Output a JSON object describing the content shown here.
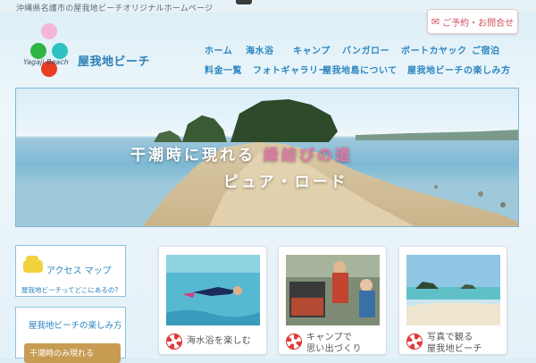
{
  "header": {
    "tagline": "沖縄県名護市の屋我地ビーチオリジナルホームページ",
    "reserve_icon": "envelope-icon",
    "reserve_label": "ご予約・お問合せ"
  },
  "logo": {
    "english": "Yagaji Beach",
    "japanese": "屋我地ビーチ",
    "colors": [
      "#f4b7d7",
      "#2fb445",
      "#2ec2c3",
      "#ea3d1f"
    ]
  },
  "nav": {
    "row1": [
      "ホーム",
      "海水浴",
      "キャンプ",
      "バンガロー",
      "ボートカヤック",
      "ご宿泊"
    ],
    "row2": [
      "料金一覧",
      "フォトギャラリー",
      "屋我地島について",
      "屋我地ビーチの楽しみ方"
    ]
  },
  "hero": {
    "line1_a": "干潮時に現れる",
    "line1_accent": "縁結びの道",
    "line2": "ピュア・ロード"
  },
  "sidebar": {
    "access_title": "アクセス マップ",
    "access_sub": "屋我地ビーチってどこにあるの?",
    "enjoy_title": "屋我地ビーチの楽しみ方",
    "enjoy_button": "干潮時のみ現れる"
  },
  "cards": [
    {
      "lines": [
        "海水浴を楽しむ"
      ],
      "icon": "life-ring-icon"
    },
    {
      "lines": [
        "キャンプで",
        "思い出づくり"
      ],
      "icon": "life-ring-icon"
    },
    {
      "lines": [
        "写真で観る",
        "屋我地ビーチ"
      ],
      "icon": "life-ring-icon"
    }
  ],
  "colors": {
    "accent": "#2e86c1",
    "pink": "#d0505f",
    "hero_accent": "#e27aa8",
    "button": "#c89b53"
  }
}
